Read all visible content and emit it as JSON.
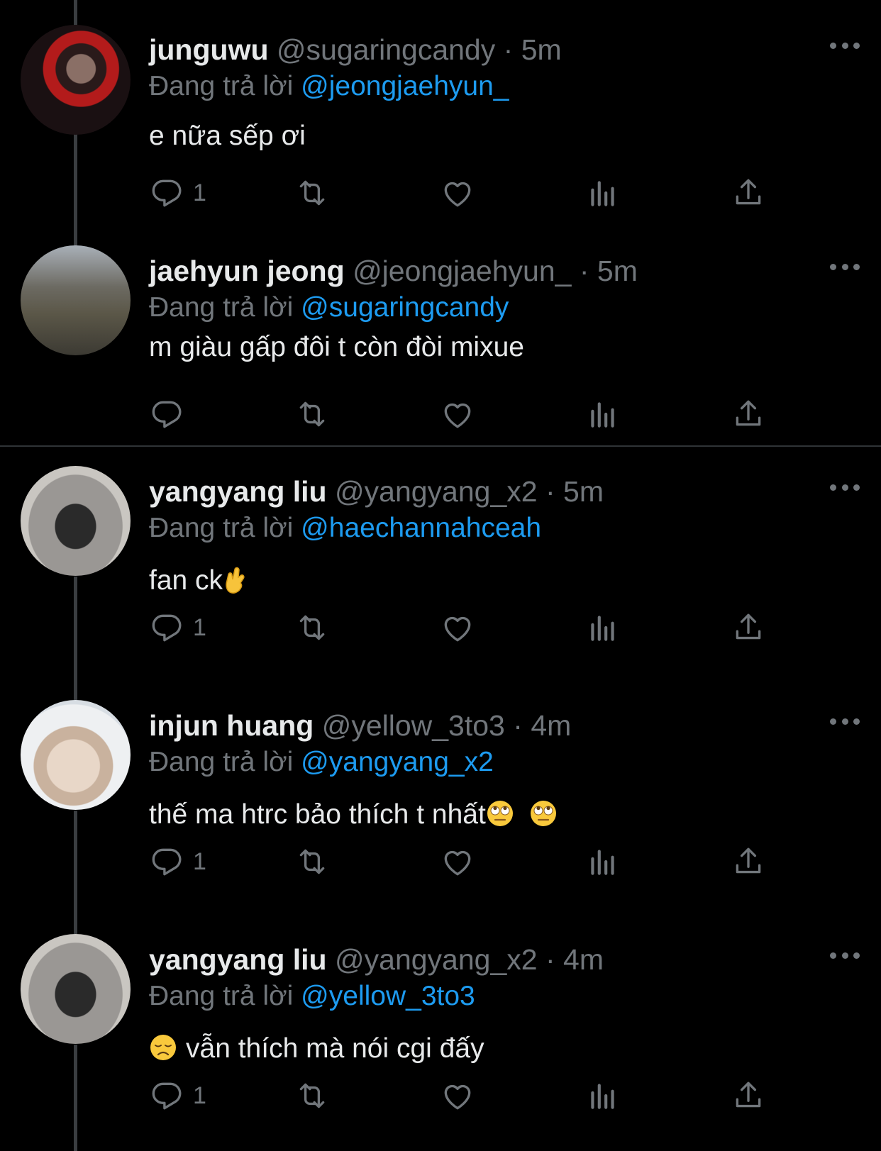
{
  "tweets": [
    {
      "name": "junguwu",
      "handle": "@sugaringcandy",
      "sep": "·",
      "time": "5m",
      "reply_prefix": "Đang trả lời",
      "reply_to": "@jeongjaehyun_",
      "text": "e nữa sếp ơi",
      "reply_count": "1",
      "avatar": "avatar-red-turtleneck"
    },
    {
      "name": "jaehyun jeong",
      "handle": "@jeongjaehyun_",
      "sep": "·",
      "time": "5m",
      "reply_prefix": "Đang trả lời",
      "reply_to": "@sugaringcandy",
      "text": "m giàu gấp đôi t còn đòi mixue",
      "reply_count": "",
      "avatar": "avatar-street"
    },
    {
      "name": "yangyang liu",
      "handle": "@yangyang_x2",
      "sep": "·",
      "time": "5m",
      "reply_prefix": "Đang trả lời",
      "reply_to": "@haechannahceah",
      "text": "fan ck",
      "reply_count": "1",
      "avatar": "avatar-mirror"
    },
    {
      "name": "injun huang",
      "handle": "@yellow_3to3",
      "sep": "·",
      "time": "4m",
      "reply_prefix": "Đang trả lời",
      "reply_to": "@yangyang_x2",
      "text": "thế ma htrc bảo thích t nhất",
      "reply_count": "1",
      "avatar": "avatar-lying"
    },
    {
      "name": "yangyang liu",
      "handle": "@yangyang_x2",
      "sep": "·",
      "time": "4m",
      "reply_prefix": "Đang trả lời",
      "reply_to": "@yellow_3to3",
      "text": "vẫn thích mà nói cgi đấy",
      "reply_count": "1",
      "avatar": "avatar-mirror"
    }
  ],
  "colors": {
    "background": "#000000",
    "text": "#e7e9ea",
    "secondary": "#71767b",
    "link": "#1d9bf0",
    "thread_line": "#3a3d40"
  },
  "icons": [
    "reply-icon",
    "retweet-icon",
    "like-icon",
    "views-icon",
    "share-icon",
    "more-icon",
    "crossed-fingers-emoji",
    "eye-roll-emoji",
    "disappointed-emoji"
  ]
}
